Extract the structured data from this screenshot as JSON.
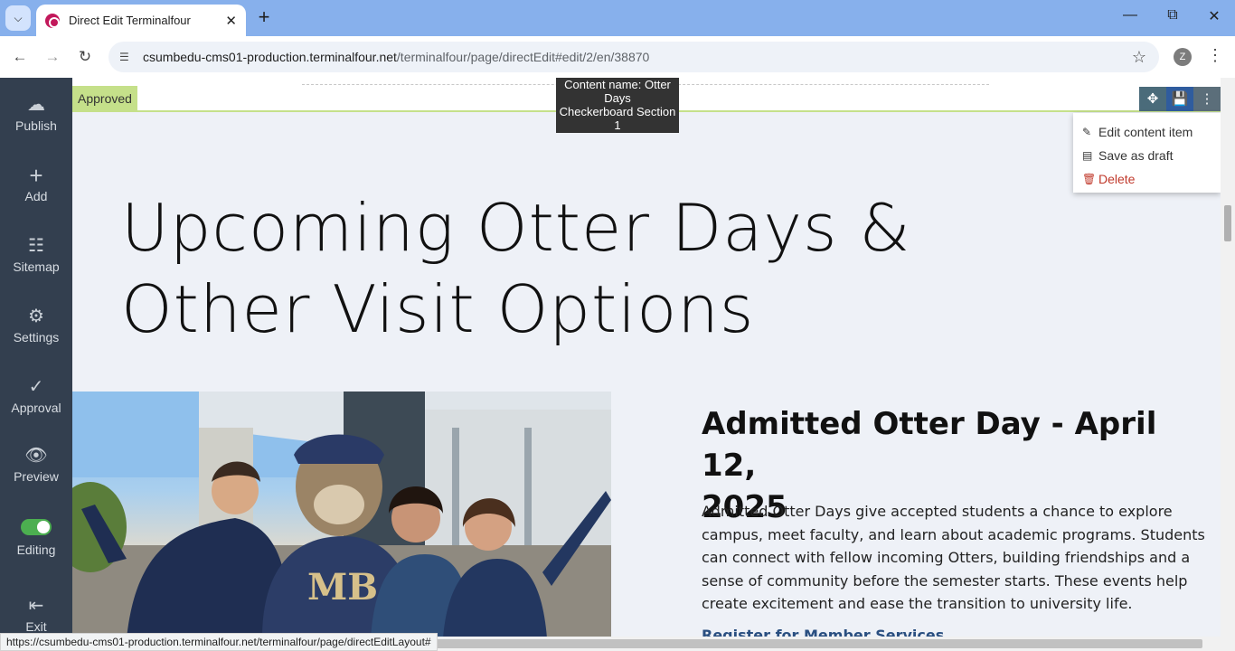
{
  "browser": {
    "tab_title": "Direct Edit Terminalfour",
    "url_host": "csumbedu-cms01-production.terminalfour.net",
    "url_path": "/terminalfour/page/directEdit#edit/2/en/38870",
    "profile_initial": "Z",
    "status_url": "https://csumbedu-cms01-production.terminalfour.net/terminalfour/page/directEditLayout#"
  },
  "sidebar": {
    "items": [
      {
        "label": "Publish",
        "icon": "cloud-upload-icon"
      },
      {
        "label": "Add",
        "icon": "plus-icon"
      },
      {
        "label": "Sitemap",
        "icon": "sitemap-icon"
      },
      {
        "label": "Settings",
        "icon": "gear-icon"
      },
      {
        "label": "Approval",
        "icon": "check-icon"
      },
      {
        "label": "Preview",
        "icon": "eye-icon"
      },
      {
        "label": "Editing",
        "icon": "toggle-on"
      },
      {
        "label": "Exit",
        "icon": "exit-icon"
      }
    ]
  },
  "editbar": {
    "status": "Approved",
    "content_name_line1": "Content name: Otter Days",
    "content_name_line2": "Checkerboard Section 1",
    "status_color": "#c5e08a"
  },
  "menu": {
    "edit": "Edit content item",
    "save_draft": "Save as draft",
    "delete": "Delete"
  },
  "page": {
    "title_line1": "Upcoming Otter Days &",
    "title_line2": "Other Visit Options",
    "section_title_line1": "Admitted Otter Day - April 12,",
    "section_title_line2": "2025",
    "section_body": "Admitted Otter Days give accepted students a chance to explore campus, meet faculty, and learn about academic programs. Students can connect with fellow incoming Otters, building friendships and a sense of community before the semester starts. These events help create excitement and ease the transition to university life.",
    "register_link": "Register for Member Services"
  }
}
